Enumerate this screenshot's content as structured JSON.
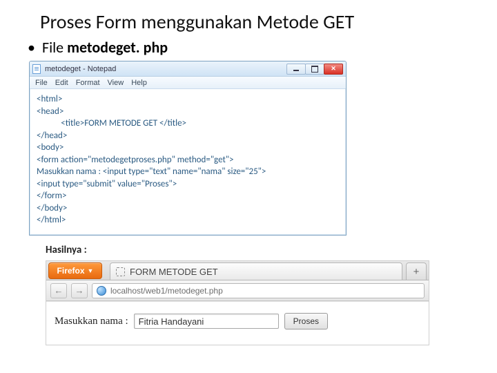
{
  "title": "Proses Form menggunakan Metode GET",
  "bullet": {
    "prefix": "File ",
    "filename": "metodeget. php"
  },
  "notepad": {
    "window_title": "metodeget - Notepad",
    "menu": [
      "File",
      "Edit",
      "Format",
      "View",
      "Help"
    ],
    "code": "<html>\n<head>\n            <title>FORM METODE GET </title>\n</head>\n<body>\n<form action=\"metodegetproses.php\" method=\"get\">\nMasukkan nama : <input type=\"text\" name=\"nama\" size=\"25\">\n<input type=\"submit\" value=\"Proses\">\n</form>\n</body>\n</html>"
  },
  "result_label": "Hasilnya :",
  "firefox": {
    "button_label": "Firefox",
    "tab_title": "FORM METODE GET",
    "newtab_label": "+",
    "nav_back": "←",
    "nav_fwd": "→",
    "address": "localhost/web1/metodeget.php",
    "page": {
      "label": "Masukkan nama :",
      "input_value": "Fitria Handayani",
      "submit_label": "Proses"
    }
  }
}
